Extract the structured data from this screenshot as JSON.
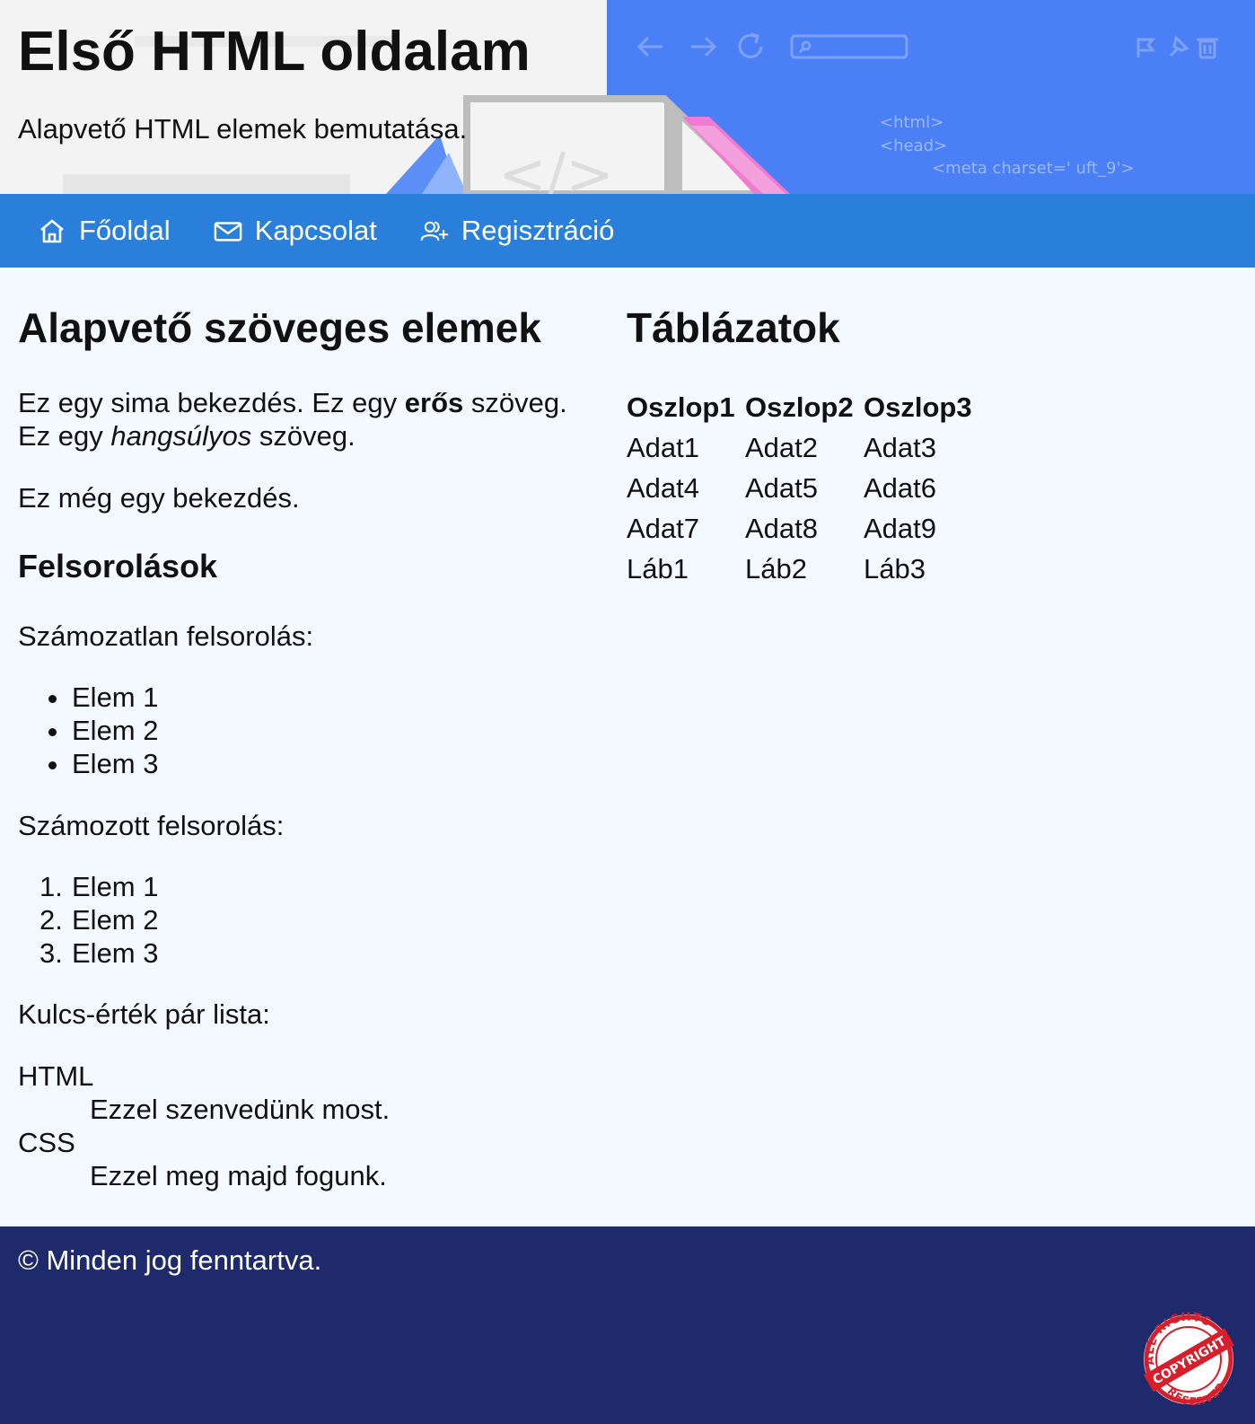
{
  "header": {
    "title": "Első HTML oldalam",
    "subtitle": "Alapvető HTML elemek bemutatása.",
    "art_code": [
      "<html>",
      "<head>",
      "<meta charset=' uft_9'>"
    ],
    "art_markup_label": "</>",
    "art_icons": [
      "back-arrow-icon",
      "forward-arrow-icon",
      "reload-icon",
      "search-icon",
      "flag-icon",
      "pin-icon",
      "trash-icon"
    ]
  },
  "nav": {
    "items": [
      {
        "label": "Főoldal",
        "icon": "home-icon"
      },
      {
        "label": "Kapcsolat",
        "icon": "mail-icon"
      },
      {
        "label": "Regisztráció",
        "icon": "add-user-icon"
      }
    ]
  },
  "left": {
    "heading": "Alapvető szöveges elemek",
    "para1": {
      "before_strong": "Ez egy sima bekezdés. Ez egy ",
      "strong": "erős",
      "after_strong": " szöveg.",
      "line2_before": "Ez egy ",
      "em": "hangsúlyos",
      "line2_after": " szöveg."
    },
    "para2": "Ez még egy bekezdés.",
    "lists_heading": "Felsorolások",
    "unordered_label": "Számozatlan felsorolás:",
    "unordered_items": [
      "Elem 1",
      "Elem 2",
      "Elem 3"
    ],
    "ordered_label": "Számozott felsorolás:",
    "ordered_numbers": [
      "1.",
      "2.",
      "3."
    ],
    "ordered_items": [
      "Elem 1",
      "Elem 2",
      "Elem 3"
    ],
    "dl_label": "Kulcs-érték pár lista:",
    "dl": [
      {
        "term": "HTML",
        "desc": "Ezzel szenvedünk most."
      },
      {
        "term": "CSS",
        "desc": "Ezzel meg majd fogunk."
      }
    ]
  },
  "right": {
    "heading": "Táblázatok",
    "table": {
      "headers": [
        "Oszlop1",
        "Oszlop2",
        "Oszlop3"
      ],
      "rows": [
        [
          "Adat1",
          "Adat2",
          "Adat3"
        ],
        [
          "Adat4",
          "Adat5",
          "Adat6"
        ],
        [
          "Adat7",
          "Adat8",
          "Adat9"
        ]
      ],
      "footer": [
        "Láb1",
        "Láb2",
        "Láb3"
      ]
    }
  },
  "footer": {
    "text": "© Minden jog fenntartva.",
    "stamp": {
      "top": "ALL RIGHTS",
      "middle": "COPYRIGHT",
      "bottom": "RESERVED"
    }
  },
  "colors": {
    "nav_bg": "#2a7fdb",
    "footer_bg": "#1e2a6b",
    "page_bg": "#f4f8ff",
    "header_art_blue": "#4a7ff5",
    "stamp_red": "#d81e2a"
  }
}
